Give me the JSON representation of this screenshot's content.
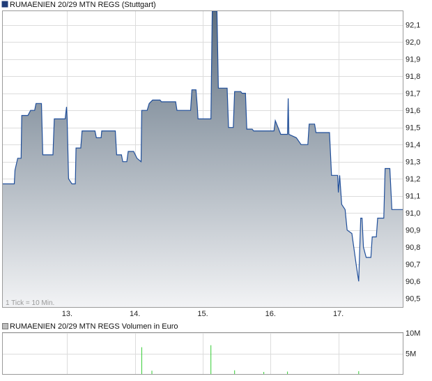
{
  "price_legend": "RUMAENIEN 20/29 MTN REGS (Stuttgart)",
  "volume_legend": "RUMAENIEN 20/29 MTN REGS Volumen in Euro",
  "tick_note": "1 Tick = 10 Min.",
  "colors": {
    "line": "#1f4e9a",
    "fill_top": "#5e6f80",
    "fill_bottom": "#f2f3f5",
    "grid": "#dcdcdc",
    "frame": "#9a9a9a",
    "volume_bar": "#33cc33",
    "price_legend_swatch": "#1f3c78",
    "volume_legend_swatch": "#bdbdbd"
  },
  "chart_data": [
    {
      "type": "area",
      "title": "RUMAENIEN 20/29 MTN REGS (Stuttgart)",
      "ylim": [
        90.45,
        92.18
      ],
      "xlim": [
        12.05,
        17.95
      ],
      "y_ticks": [
        90.5,
        90.6,
        90.7,
        90.8,
        90.9,
        91.0,
        91.1,
        91.2,
        91.3,
        91.4,
        91.5,
        91.6,
        91.7,
        91.8,
        91.9,
        92.0,
        92.1
      ],
      "y_tick_labels": [
        "90,5",
        "90,6",
        "90,7",
        "90,8",
        "90,9",
        "91,0",
        "91,1",
        "91,2",
        "91,3",
        "91,4",
        "91,5",
        "91,6",
        "91,7",
        "91,8",
        "91,9",
        "92,0",
        "92,1"
      ],
      "x_ticks": [
        13,
        14,
        15,
        16,
        17
      ],
      "x_tick_labels": [
        "13.",
        "14.",
        "15.",
        "16.",
        "17."
      ],
      "grid": true,
      "points": [
        [
          12.05,
          91.17
        ],
        [
          12.22,
          91.17
        ],
        [
          12.23,
          91.25
        ],
        [
          12.27,
          91.32
        ],
        [
          12.32,
          91.32
        ],
        [
          12.33,
          91.57
        ],
        [
          12.42,
          91.57
        ],
        [
          12.46,
          91.6
        ],
        [
          12.52,
          91.6
        ],
        [
          12.54,
          91.64
        ],
        [
          12.62,
          91.64
        ],
        [
          12.64,
          91.34
        ],
        [
          12.79,
          91.34
        ],
        [
          12.81,
          91.55
        ],
        [
          12.97,
          91.55
        ],
        [
          12.99,
          91.62
        ],
        [
          13.0,
          91.55
        ],
        [
          13.02,
          91.2
        ],
        [
          13.07,
          91.17
        ],
        [
          13.12,
          91.17
        ],
        [
          13.13,
          91.38
        ],
        [
          13.2,
          91.38
        ],
        [
          13.22,
          91.48
        ],
        [
          13.41,
          91.48
        ],
        [
          13.43,
          91.44
        ],
        [
          13.5,
          91.44
        ],
        [
          13.51,
          91.48
        ],
        [
          13.71,
          91.48
        ],
        [
          13.73,
          91.34
        ],
        [
          13.8,
          91.34
        ],
        [
          13.82,
          91.3
        ],
        [
          13.88,
          91.3
        ],
        [
          13.9,
          91.36
        ],
        [
          13.98,
          91.36
        ],
        [
          14.03,
          91.32
        ],
        [
          14.09,
          91.3
        ],
        [
          14.1,
          91.6
        ],
        [
          14.18,
          91.6
        ],
        [
          14.21,
          91.64
        ],
        [
          14.26,
          91.66
        ],
        [
          14.37,
          91.66
        ],
        [
          14.39,
          91.65
        ],
        [
          14.6,
          91.65
        ],
        [
          14.62,
          91.6
        ],
        [
          14.82,
          91.6
        ],
        [
          14.84,
          91.72
        ],
        [
          14.9,
          91.72
        ],
        [
          14.92,
          91.62
        ],
        [
          14.93,
          91.55
        ],
        [
          15.12,
          91.55
        ],
        [
          15.14,
          92.18
        ],
        [
          15.21,
          92.18
        ],
        [
          15.23,
          91.73
        ],
        [
          15.36,
          91.73
        ],
        [
          15.38,
          91.5
        ],
        [
          15.45,
          91.5
        ],
        [
          15.47,
          91.71
        ],
        [
          15.56,
          91.71
        ],
        [
          15.58,
          91.7
        ],
        [
          15.63,
          91.7
        ],
        [
          15.65,
          91.49
        ],
        [
          15.73,
          91.49
        ],
        [
          15.75,
          91.48
        ],
        [
          16.05,
          91.48
        ],
        [
          16.07,
          91.54
        ],
        [
          16.12,
          91.49
        ],
        [
          16.15,
          91.46
        ],
        [
          16.25,
          91.46
        ],
        [
          16.26,
          91.67
        ],
        [
          16.27,
          91.46
        ],
        [
          16.38,
          91.44
        ],
        [
          16.45,
          91.4
        ],
        [
          16.55,
          91.4
        ],
        [
          16.57,
          91.52
        ],
        [
          16.65,
          91.52
        ],
        [
          16.67,
          91.47
        ],
        [
          16.87,
          91.47
        ],
        [
          16.9,
          91.22
        ],
        [
          16.99,
          91.22
        ],
        [
          17.0,
          91.12
        ],
        [
          17.02,
          91.22
        ],
        [
          17.05,
          91.05
        ],
        [
          17.1,
          91.02
        ],
        [
          17.13,
          90.9
        ],
        [
          17.2,
          90.88
        ],
        [
          17.27,
          90.68
        ],
        [
          17.3,
          90.6
        ],
        [
          17.33,
          90.97
        ],
        [
          17.35,
          90.97
        ],
        [
          17.37,
          90.8
        ],
        [
          17.41,
          90.74
        ],
        [
          17.48,
          90.74
        ],
        [
          17.5,
          90.86
        ],
        [
          17.56,
          90.86
        ],
        [
          17.58,
          90.97
        ],
        [
          17.67,
          90.97
        ],
        [
          17.69,
          91.26
        ],
        [
          17.76,
          91.26
        ],
        [
          17.79,
          91.02
        ],
        [
          17.95,
          91.02
        ]
      ]
    },
    {
      "type": "bar",
      "title": "RUMAENIEN 20/29 MTN REGS Volumen in Euro",
      "ylim": [
        0,
        10
      ],
      "y_ticks": [
        5,
        10
      ],
      "y_tick_labels": [
        "5M",
        "10M"
      ],
      "unit": "M",
      "x_ticks": [
        13,
        14,
        15,
        16,
        17
      ],
      "grid": true,
      "points": [
        [
          14.1,
          6.5
        ],
        [
          14.25,
          0.8
        ],
        [
          15.12,
          7.0
        ],
        [
          15.47,
          0.9
        ],
        [
          15.9,
          0.5
        ],
        [
          16.25,
          0.6
        ],
        [
          17.3,
          0.7
        ]
      ]
    }
  ]
}
